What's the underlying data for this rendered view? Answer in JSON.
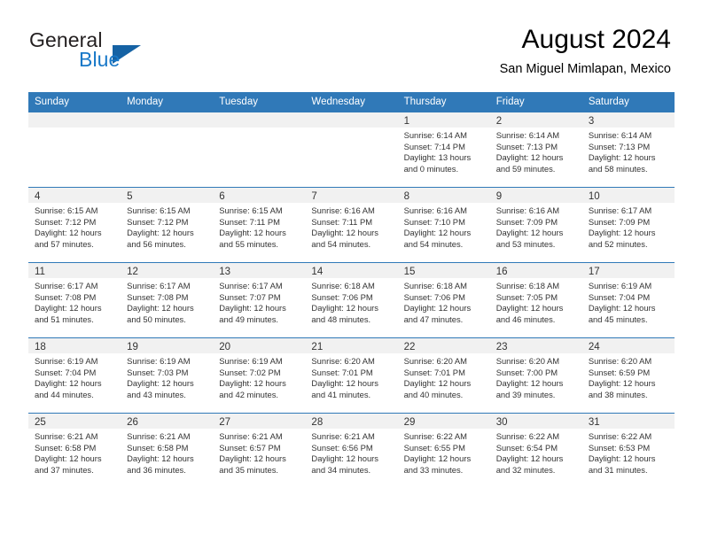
{
  "brand": {
    "name_part1": "General",
    "name_part2": "Blue",
    "logo_icon": "triangle-flag-icon",
    "accent_color": "#1878c8",
    "triangle_color": "#1562a4"
  },
  "header": {
    "title": "August 2024",
    "subtitle": "San Miguel Mimlapan, Mexico"
  },
  "theme": {
    "header_row_bg": "#3079b8",
    "header_row_text": "#ffffff",
    "daynum_band_bg": "#f1f1f1",
    "cell_border": "#3079b8",
    "body_text": "#333333"
  },
  "weekdays": [
    "Sunday",
    "Monday",
    "Tuesday",
    "Wednesday",
    "Thursday",
    "Friday",
    "Saturday"
  ],
  "weeks": [
    [
      {
        "day": "",
        "empty": true,
        "sunrise": "",
        "sunset": "",
        "daylight_line1": "",
        "daylight_line2": ""
      },
      {
        "day": "",
        "empty": true,
        "sunrise": "",
        "sunset": "",
        "daylight_line1": "",
        "daylight_line2": ""
      },
      {
        "day": "",
        "empty": true,
        "sunrise": "",
        "sunset": "",
        "daylight_line1": "",
        "daylight_line2": ""
      },
      {
        "day": "",
        "empty": true,
        "sunrise": "",
        "sunset": "",
        "daylight_line1": "",
        "daylight_line2": ""
      },
      {
        "day": "1",
        "empty": false,
        "sunrise": "Sunrise: 6:14 AM",
        "sunset": "Sunset: 7:14 PM",
        "daylight_line1": "Daylight: 13 hours",
        "daylight_line2": "and 0 minutes."
      },
      {
        "day": "2",
        "empty": false,
        "sunrise": "Sunrise: 6:14 AM",
        "sunset": "Sunset: 7:13 PM",
        "daylight_line1": "Daylight: 12 hours",
        "daylight_line2": "and 59 minutes."
      },
      {
        "day": "3",
        "empty": false,
        "sunrise": "Sunrise: 6:14 AM",
        "sunset": "Sunset: 7:13 PM",
        "daylight_line1": "Daylight: 12 hours",
        "daylight_line2": "and 58 minutes."
      }
    ],
    [
      {
        "day": "4",
        "empty": false,
        "sunrise": "Sunrise: 6:15 AM",
        "sunset": "Sunset: 7:12 PM",
        "daylight_line1": "Daylight: 12 hours",
        "daylight_line2": "and 57 minutes."
      },
      {
        "day": "5",
        "empty": false,
        "sunrise": "Sunrise: 6:15 AM",
        "sunset": "Sunset: 7:12 PM",
        "daylight_line1": "Daylight: 12 hours",
        "daylight_line2": "and 56 minutes."
      },
      {
        "day": "6",
        "empty": false,
        "sunrise": "Sunrise: 6:15 AM",
        "sunset": "Sunset: 7:11 PM",
        "daylight_line1": "Daylight: 12 hours",
        "daylight_line2": "and 55 minutes."
      },
      {
        "day": "7",
        "empty": false,
        "sunrise": "Sunrise: 6:16 AM",
        "sunset": "Sunset: 7:11 PM",
        "daylight_line1": "Daylight: 12 hours",
        "daylight_line2": "and 54 minutes."
      },
      {
        "day": "8",
        "empty": false,
        "sunrise": "Sunrise: 6:16 AM",
        "sunset": "Sunset: 7:10 PM",
        "daylight_line1": "Daylight: 12 hours",
        "daylight_line2": "and 54 minutes."
      },
      {
        "day": "9",
        "empty": false,
        "sunrise": "Sunrise: 6:16 AM",
        "sunset": "Sunset: 7:09 PM",
        "daylight_line1": "Daylight: 12 hours",
        "daylight_line2": "and 53 minutes."
      },
      {
        "day": "10",
        "empty": false,
        "sunrise": "Sunrise: 6:17 AM",
        "sunset": "Sunset: 7:09 PM",
        "daylight_line1": "Daylight: 12 hours",
        "daylight_line2": "and 52 minutes."
      }
    ],
    [
      {
        "day": "11",
        "empty": false,
        "sunrise": "Sunrise: 6:17 AM",
        "sunset": "Sunset: 7:08 PM",
        "daylight_line1": "Daylight: 12 hours",
        "daylight_line2": "and 51 minutes."
      },
      {
        "day": "12",
        "empty": false,
        "sunrise": "Sunrise: 6:17 AM",
        "sunset": "Sunset: 7:08 PM",
        "daylight_line1": "Daylight: 12 hours",
        "daylight_line2": "and 50 minutes."
      },
      {
        "day": "13",
        "empty": false,
        "sunrise": "Sunrise: 6:17 AM",
        "sunset": "Sunset: 7:07 PM",
        "daylight_line1": "Daylight: 12 hours",
        "daylight_line2": "and 49 minutes."
      },
      {
        "day": "14",
        "empty": false,
        "sunrise": "Sunrise: 6:18 AM",
        "sunset": "Sunset: 7:06 PM",
        "daylight_line1": "Daylight: 12 hours",
        "daylight_line2": "and 48 minutes."
      },
      {
        "day": "15",
        "empty": false,
        "sunrise": "Sunrise: 6:18 AM",
        "sunset": "Sunset: 7:06 PM",
        "daylight_line1": "Daylight: 12 hours",
        "daylight_line2": "and 47 minutes."
      },
      {
        "day": "16",
        "empty": false,
        "sunrise": "Sunrise: 6:18 AM",
        "sunset": "Sunset: 7:05 PM",
        "daylight_line1": "Daylight: 12 hours",
        "daylight_line2": "and 46 minutes."
      },
      {
        "day": "17",
        "empty": false,
        "sunrise": "Sunrise: 6:19 AM",
        "sunset": "Sunset: 7:04 PM",
        "daylight_line1": "Daylight: 12 hours",
        "daylight_line2": "and 45 minutes."
      }
    ],
    [
      {
        "day": "18",
        "empty": false,
        "sunrise": "Sunrise: 6:19 AM",
        "sunset": "Sunset: 7:04 PM",
        "daylight_line1": "Daylight: 12 hours",
        "daylight_line2": "and 44 minutes."
      },
      {
        "day": "19",
        "empty": false,
        "sunrise": "Sunrise: 6:19 AM",
        "sunset": "Sunset: 7:03 PM",
        "daylight_line1": "Daylight: 12 hours",
        "daylight_line2": "and 43 minutes."
      },
      {
        "day": "20",
        "empty": false,
        "sunrise": "Sunrise: 6:19 AM",
        "sunset": "Sunset: 7:02 PM",
        "daylight_line1": "Daylight: 12 hours",
        "daylight_line2": "and 42 minutes."
      },
      {
        "day": "21",
        "empty": false,
        "sunrise": "Sunrise: 6:20 AM",
        "sunset": "Sunset: 7:01 PM",
        "daylight_line1": "Daylight: 12 hours",
        "daylight_line2": "and 41 minutes."
      },
      {
        "day": "22",
        "empty": false,
        "sunrise": "Sunrise: 6:20 AM",
        "sunset": "Sunset: 7:01 PM",
        "daylight_line1": "Daylight: 12 hours",
        "daylight_line2": "and 40 minutes."
      },
      {
        "day": "23",
        "empty": false,
        "sunrise": "Sunrise: 6:20 AM",
        "sunset": "Sunset: 7:00 PM",
        "daylight_line1": "Daylight: 12 hours",
        "daylight_line2": "and 39 minutes."
      },
      {
        "day": "24",
        "empty": false,
        "sunrise": "Sunrise: 6:20 AM",
        "sunset": "Sunset: 6:59 PM",
        "daylight_line1": "Daylight: 12 hours",
        "daylight_line2": "and 38 minutes."
      }
    ],
    [
      {
        "day": "25",
        "empty": false,
        "sunrise": "Sunrise: 6:21 AM",
        "sunset": "Sunset: 6:58 PM",
        "daylight_line1": "Daylight: 12 hours",
        "daylight_line2": "and 37 minutes."
      },
      {
        "day": "26",
        "empty": false,
        "sunrise": "Sunrise: 6:21 AM",
        "sunset": "Sunset: 6:58 PM",
        "daylight_line1": "Daylight: 12 hours",
        "daylight_line2": "and 36 minutes."
      },
      {
        "day": "27",
        "empty": false,
        "sunrise": "Sunrise: 6:21 AM",
        "sunset": "Sunset: 6:57 PM",
        "daylight_line1": "Daylight: 12 hours",
        "daylight_line2": "and 35 minutes."
      },
      {
        "day": "28",
        "empty": false,
        "sunrise": "Sunrise: 6:21 AM",
        "sunset": "Sunset: 6:56 PM",
        "daylight_line1": "Daylight: 12 hours",
        "daylight_line2": "and 34 minutes."
      },
      {
        "day": "29",
        "empty": false,
        "sunrise": "Sunrise: 6:22 AM",
        "sunset": "Sunset: 6:55 PM",
        "daylight_line1": "Daylight: 12 hours",
        "daylight_line2": "and 33 minutes."
      },
      {
        "day": "30",
        "empty": false,
        "sunrise": "Sunrise: 6:22 AM",
        "sunset": "Sunset: 6:54 PM",
        "daylight_line1": "Daylight: 12 hours",
        "daylight_line2": "and 32 minutes."
      },
      {
        "day": "31",
        "empty": false,
        "sunrise": "Sunrise: 6:22 AM",
        "sunset": "Sunset: 6:53 PM",
        "daylight_line1": "Daylight: 12 hours",
        "daylight_line2": "and 31 minutes."
      }
    ]
  ]
}
